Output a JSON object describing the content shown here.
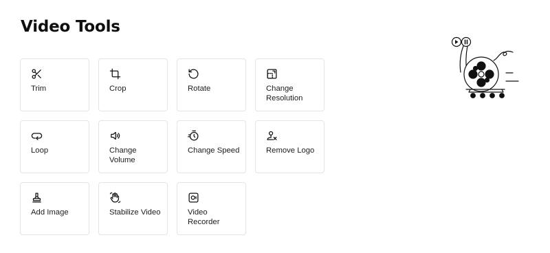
{
  "page": {
    "title": "Video Tools"
  },
  "tools": [
    {
      "name": "trim",
      "label": "Trim",
      "icon": "scissors-icon"
    },
    {
      "name": "crop",
      "label": "Crop",
      "icon": "crop-icon"
    },
    {
      "name": "rotate",
      "label": "Rotate",
      "icon": "rotate-icon"
    },
    {
      "name": "change-resolution",
      "label": "Change Resolution",
      "icon": "resolution-icon"
    },
    {
      "name": "loop",
      "label": "Loop",
      "icon": "loop-icon"
    },
    {
      "name": "change-volume",
      "label": "Change Volume",
      "icon": "volume-icon"
    },
    {
      "name": "change-speed",
      "label": "Change Speed",
      "icon": "speed-timer-icon"
    },
    {
      "name": "remove-logo",
      "label": "Remove Logo",
      "icon": "remove-logo-icon"
    },
    {
      "name": "add-image",
      "label": "Add Image",
      "icon": "stamp-icon"
    },
    {
      "name": "stabilize-video",
      "label": "Stabilize Video",
      "icon": "stabilize-hand-icon"
    },
    {
      "name": "video-recorder",
      "label": "Video Recorder",
      "icon": "video-recorder-icon"
    }
  ],
  "illustration": {
    "icon": "film-reel-illustration"
  },
  "colors": {
    "text": "#111111",
    "card_border": "#e4e4e4",
    "background": "#ffffff"
  }
}
